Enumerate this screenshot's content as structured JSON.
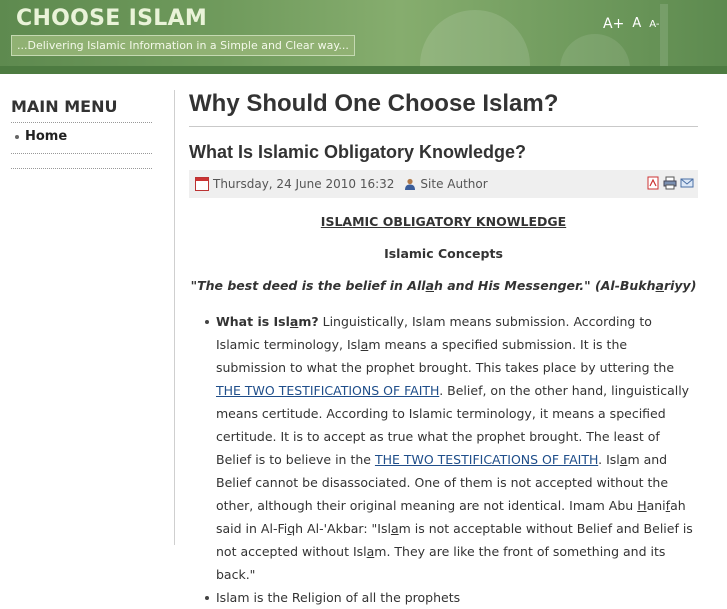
{
  "header": {
    "site_title": "CHOOSE ISLAM",
    "tagline": "...Delivering Islamic Information in a Simple and Clear way...",
    "font_controls": {
      "increase": "A+",
      "reset": "A",
      "decrease": "A-"
    }
  },
  "sidebar": {
    "menu_title": "MAIN MENU",
    "items": [
      {
        "label": "Home"
      }
    ]
  },
  "main": {
    "page_title": "Why Should One Choose Islam?",
    "article_title": "What Is Islamic Obligatory Knowledge?",
    "meta": {
      "date": "Thursday, 24 June 2010 16:32",
      "author": "Site Author",
      "icons": [
        "pdf-icon",
        "print-icon",
        "email-icon"
      ]
    },
    "content": {
      "heading1": "ISLAMIC OBLIGATORY KNOWLEDGE",
      "heading2": "Islamic Concepts",
      "quote_a": "\"The best deed is the belief in All",
      "quote_b": "a",
      "quote_c": "h and His Messenger.\" (Al-Bukh",
      "quote_d": "a",
      "quote_e": "riyy)",
      "p1_lead_a": "What is Isl",
      "p1_lead_b": "a",
      "p1_lead_c": "m?",
      "p1_t1": " Linguistically, Islam means submission. According to Islamic terminology, Isl",
      "p1_t1b": "a",
      "p1_t1c": "m means a specified submission. It is the submission to what the prophet brought. This takes place by uttering the ",
      "link1": "THE TWO TESTIFICATIONS OF FAITH",
      "p1_t2": ". Belief, on the other hand, linguistically means certitude. According to Islamic terminology, it means a specified certitude. It is to accept as true what the prophet brought. The least of Belief is to believe in the ",
      "link2": "THE TWO TESTIFICATIONS OF FAITH",
      "p1_t3a": ". Isl",
      "p1_t3b": "a",
      "p1_t3c": "m and Belief cannot be disassociated. One of them is not accepted without the other, although their original meaning are not identical. Imam Abu ",
      "p1_t3d": "H",
      "p1_t3e": "ani",
      "p1_t3f": "f",
      "p1_t3g": "ah said in Al-Fi",
      "p1_t3h": "q",
      "p1_t3i": "h Al-'Akbar: \"Isl",
      "p1_t3j": "a",
      "p1_t3k": "m is not acceptable without Belief and Belief is not accepted without Isl",
      "p1_t3l": "a",
      "p1_t3m": "m. They are like the front of something and its back.\"",
      "p2": "Islam is the Religion of all the prophets"
    }
  }
}
